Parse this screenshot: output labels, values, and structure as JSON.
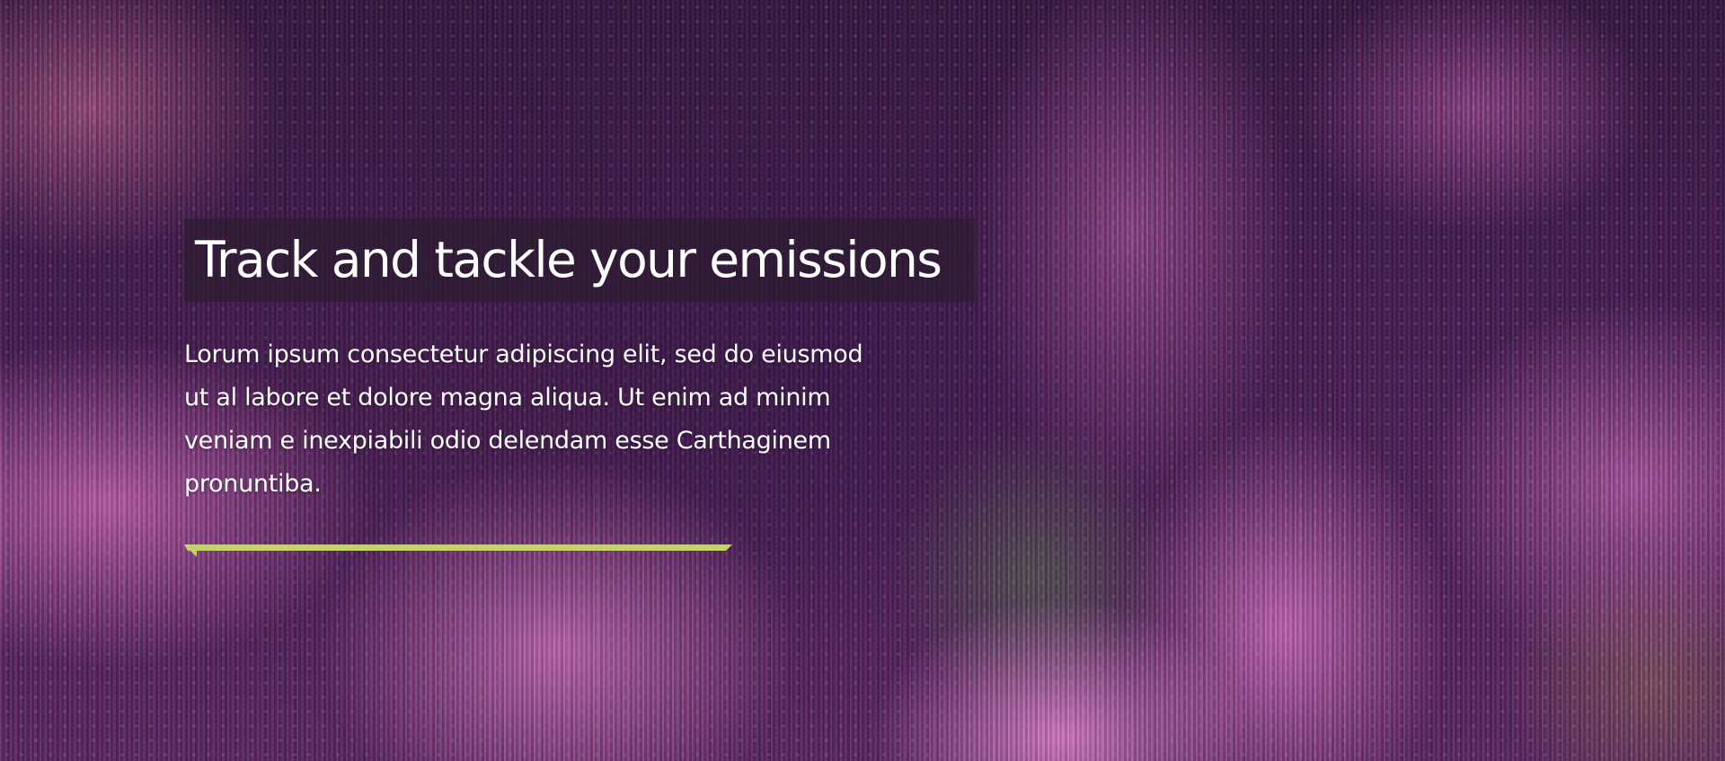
{
  "hero": {
    "title": "Track and tackle  your emissions",
    "body": "Lorum ipsum consectetur adipiscing elit, sed do eiusmod ut al labore et dolore magna aliqua. Ut enim ad minim veniam e inexpiabili odio delendam esse Carthaginem pronuntiba.",
    "accent_color": "#c3d173"
  }
}
